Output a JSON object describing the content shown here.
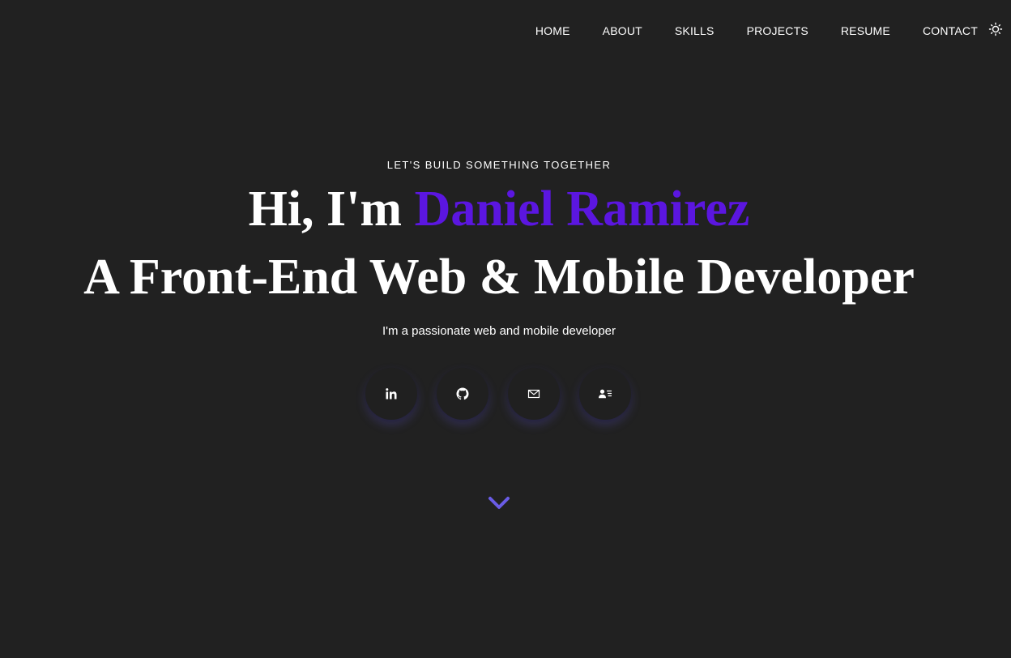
{
  "nav": {
    "items": [
      {
        "label": "HOME"
      },
      {
        "label": "ABOUT"
      },
      {
        "label": "SKILLS"
      },
      {
        "label": "PROJECTS"
      },
      {
        "label": "RESUME"
      },
      {
        "label": "CONTACT"
      }
    ],
    "theme_toggle_icon": "sun-icon"
  },
  "hero": {
    "tagline": "LET'S BUILD SOMETHING TOGETHER",
    "greeting": "Hi, I'm ",
    "name": "Daniel Ramirez",
    "title": "A Front-End Web & Mobile Developer",
    "description": "I'm a passionate web and mobile developer"
  },
  "socials": [
    {
      "icon": "linkedin-icon"
    },
    {
      "icon": "github-icon"
    },
    {
      "icon": "mail-icon"
    },
    {
      "icon": "contact-card-icon"
    }
  ],
  "scroll_icon": "chevron-down-icon",
  "colors": {
    "background": "#212121",
    "accent": "#5b16e0",
    "chevron": "#6a5ce6",
    "text": "#ffffff"
  }
}
